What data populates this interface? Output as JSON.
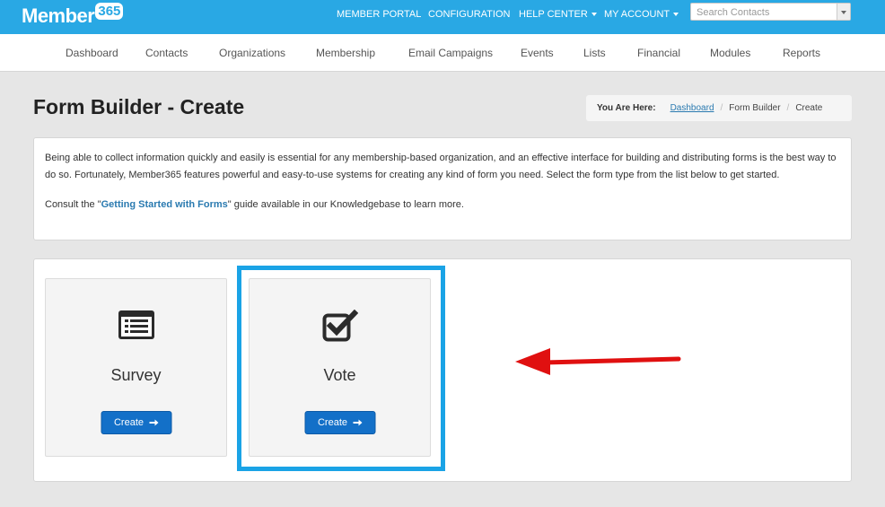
{
  "header": {
    "logo_word": "Member",
    "logo_number": "365",
    "nav": [
      {
        "label": "MEMBER PORTAL"
      },
      {
        "label": "CONFIGURATION"
      },
      {
        "label": "HELP CENTER"
      },
      {
        "label": "MY ACCOUNT"
      }
    ],
    "search_placeholder": "Search Contacts"
  },
  "main_nav": [
    "Dashboard",
    "Contacts",
    "Organizations",
    "Membership",
    "Email Campaigns",
    "Events",
    "Lists",
    "Financial",
    "Modules",
    "Reports"
  ],
  "page": {
    "title": "Form Builder - Create",
    "breadcrumb": {
      "prefix": "You Are Here:",
      "items": [
        "Dashboard",
        "Form Builder",
        "Create"
      ],
      "separator": "/"
    }
  },
  "intro": {
    "paragraph": "Being able to collect information quickly and easily is essential for any membership-based organization, and an effective interface for building and distributing forms is the best way to do so. Fortunately, Member365 features powerful and easy-to-use systems for creating any kind of form you need. Select the form type from the list below to get started.",
    "consult_before": "Consult the \"",
    "guide_link": "Getting Started with Forms",
    "consult_after": "\" guide available in our Knowledgebase to learn more."
  },
  "form_types": [
    {
      "name": "Survey",
      "icon": "list-icon",
      "button_label": "Create"
    },
    {
      "name": "Vote",
      "icon": "checkbox-check-icon",
      "button_label": "Create"
    }
  ],
  "colors": {
    "header_bg": "#29a8e4",
    "button_bg": "#1370c8",
    "highlight": "#1aa3e6",
    "annotation_arrow": "#e01010"
  }
}
